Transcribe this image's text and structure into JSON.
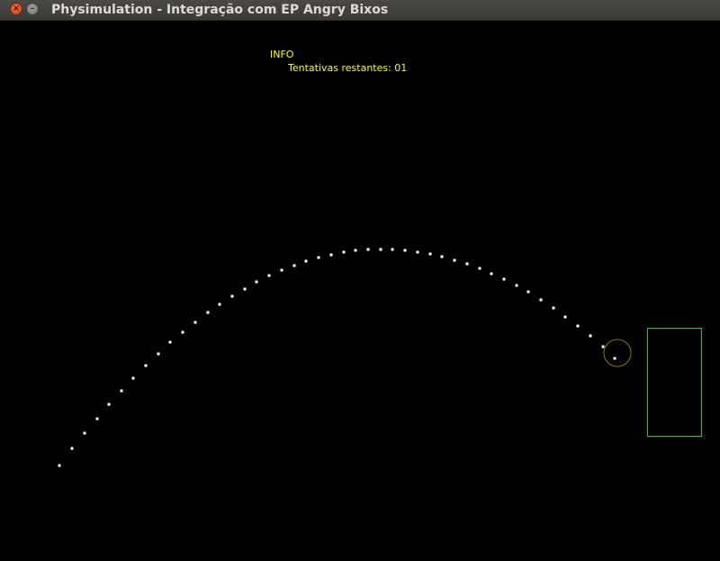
{
  "window": {
    "title": "Physimulation - Integração com EP Angry Bixos",
    "close_icon": "close-icon",
    "minimize_icon": "minimize-icon"
  },
  "info": {
    "heading": "INFO",
    "attempts_text": "Tentativas restantes: 01"
  },
  "colors": {
    "background": "#000000",
    "text": "#ffff00",
    "trajectory": "#ffffff",
    "projectile_outline": "#8a7a10",
    "target_outline": "#22cc22"
  }
}
